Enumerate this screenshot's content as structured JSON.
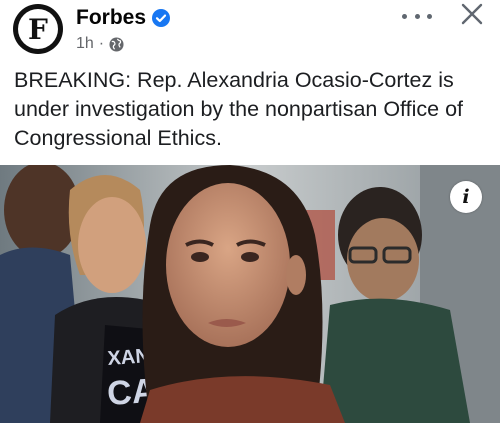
{
  "page": {
    "name": "Forbes",
    "avatar_letter": "F",
    "verified_icon": "verified-badge-icon",
    "time": "1h",
    "separator": "·",
    "audience_icon": "globe-icon",
    "accent_color": "#1877f2"
  },
  "post": {
    "text": "BREAKING: Rep. Alexandria Ocasio-Cortez is under investigation by the nonpartisan Office of Congressional Ethics."
  },
  "photo": {
    "shirt_text": "XAND CAS",
    "info_glyph": "i"
  },
  "actions": {
    "more_icon": "more-options-icon",
    "close_icon": "close-icon"
  }
}
